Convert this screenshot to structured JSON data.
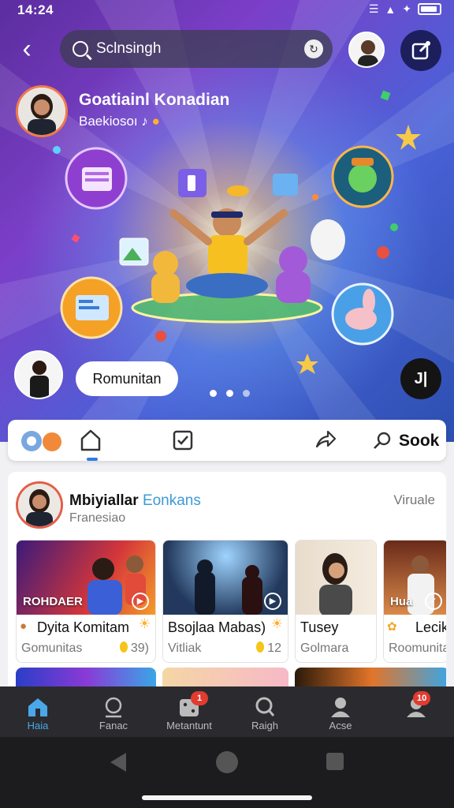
{
  "status": {
    "time": "14:24"
  },
  "header": {
    "back_icon": "back-arrow-icon",
    "search_text": "Sclnsingh",
    "compose_icon": "compose-icon"
  },
  "profile": {
    "name": "Goatiainl Konadian",
    "subtitle": "Baekiosoı"
  },
  "hero": {
    "pill_label": "Romunitan",
    "music_label": "J|"
  },
  "tabs": {
    "search_label": "Sook"
  },
  "feed": {
    "title": "Mbiyiallar",
    "title_accent": "Eonkans",
    "subtitle": "Franesiao",
    "tag": "Viruale",
    "cards": [
      {
        "img_label": "ROHDAER",
        "title": "Dyita Komitam",
        "subtitle": "Gomunitas",
        "count": "39)"
      },
      {
        "img_label": "",
        "title": "Bsojlaa Mabas)",
        "subtitle": "Vitliak",
        "count": "12"
      },
      {
        "img_label": "",
        "title": "Tusey",
        "subtitle": "Golmara",
        "count": ""
      },
      {
        "img_label": "Hua",
        "title": "Lecik",
        "subtitle": "Roomunita",
        "count": ""
      }
    ]
  },
  "bottom_nav": [
    {
      "label": "Haia",
      "icon": "home-icon"
    },
    {
      "label": "Fanac",
      "icon": "search-person-icon"
    },
    {
      "label": "Metantunt",
      "icon": "dice-icon",
      "badge": "1"
    },
    {
      "label": "Raigh",
      "icon": "search-icon"
    },
    {
      "label": "Acse",
      "icon": "person-icon"
    },
    {
      "label": "",
      "icon": "profile-icon",
      "badge": "10"
    }
  ],
  "colors": {
    "accent": "#2f7be5",
    "badge": "#e03c2f",
    "nav_bg": "#2b2b2f",
    "hero_purple": "#7b3fc8"
  }
}
